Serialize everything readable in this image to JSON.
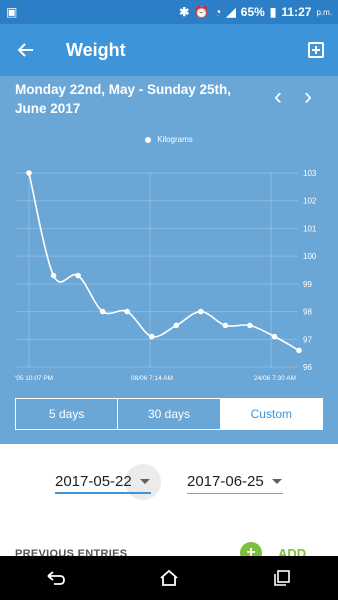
{
  "status_bar": {
    "battery": "65%",
    "time": "11:27",
    "ampm": "p.m."
  },
  "app_bar": {
    "title": "Weight"
  },
  "chart_header": {
    "date_range": "Monday 22nd, May - Sunday 25th, June 2017"
  },
  "segments": [
    {
      "label": "5 days",
      "active": false
    },
    {
      "label": "30 days",
      "active": false
    },
    {
      "label": "Custom",
      "active": true
    }
  ],
  "date_fields": {
    "from": "2017-05-22",
    "to": "2017-06-25"
  },
  "entries": {
    "title": "PREVIOUS ENTRIES",
    "add_label": "ADD"
  },
  "colors": {
    "status_bar": "#2c7fc6",
    "app_bar": "#3d94d8",
    "chart_bg": "#6aa6d6",
    "accent_green": "#7bbf3a"
  },
  "icons": {
    "back": "arrow-left-icon",
    "add_entry": "add-box-icon",
    "prev": "chevron-left-icon",
    "next": "chevron-right-icon"
  },
  "chart_data": {
    "type": "line",
    "legend": "Kilograms",
    "x_tick_labels": [
      "'05 10:07 PM",
      "08/06 7:14 AM",
      "24/06 7:30 AM"
    ],
    "y_ticks": [
      96,
      97,
      98,
      99,
      100,
      101,
      102,
      103
    ],
    "ylim": [
      96,
      103
    ],
    "series": [
      {
        "name": "Kilograms",
        "values": [
          103,
          99.3,
          99.3,
          98,
          98,
          97.1,
          97.5,
          98,
          97.5,
          97.5,
          97.1,
          96.6
        ]
      }
    ],
    "grid": true,
    "legend_position": "top-center"
  }
}
